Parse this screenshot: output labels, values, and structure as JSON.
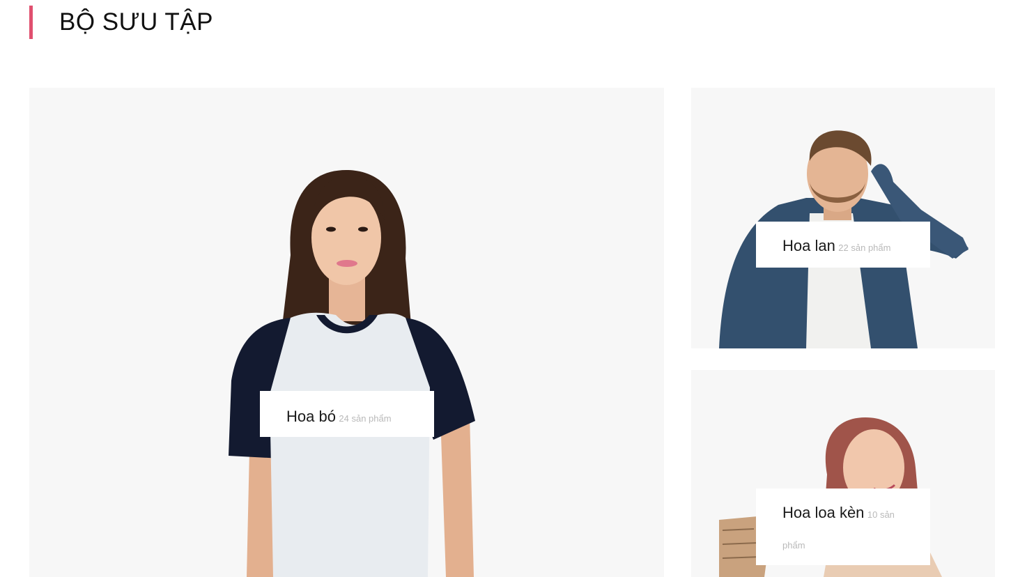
{
  "section": {
    "title": "BỘ SƯU TẬP"
  },
  "collections": [
    {
      "name": "Hoa bó",
      "count": "24 sản phẩm"
    },
    {
      "name": "Hoa lan",
      "count": "22 sản phẩm"
    },
    {
      "name": "Hoa loa kèn",
      "count": "10 sản phẩm"
    }
  ],
  "colors": {
    "accent": "#e0506f",
    "card_bg": "#f7f7f7",
    "count_text": "#b9b9b9"
  }
}
